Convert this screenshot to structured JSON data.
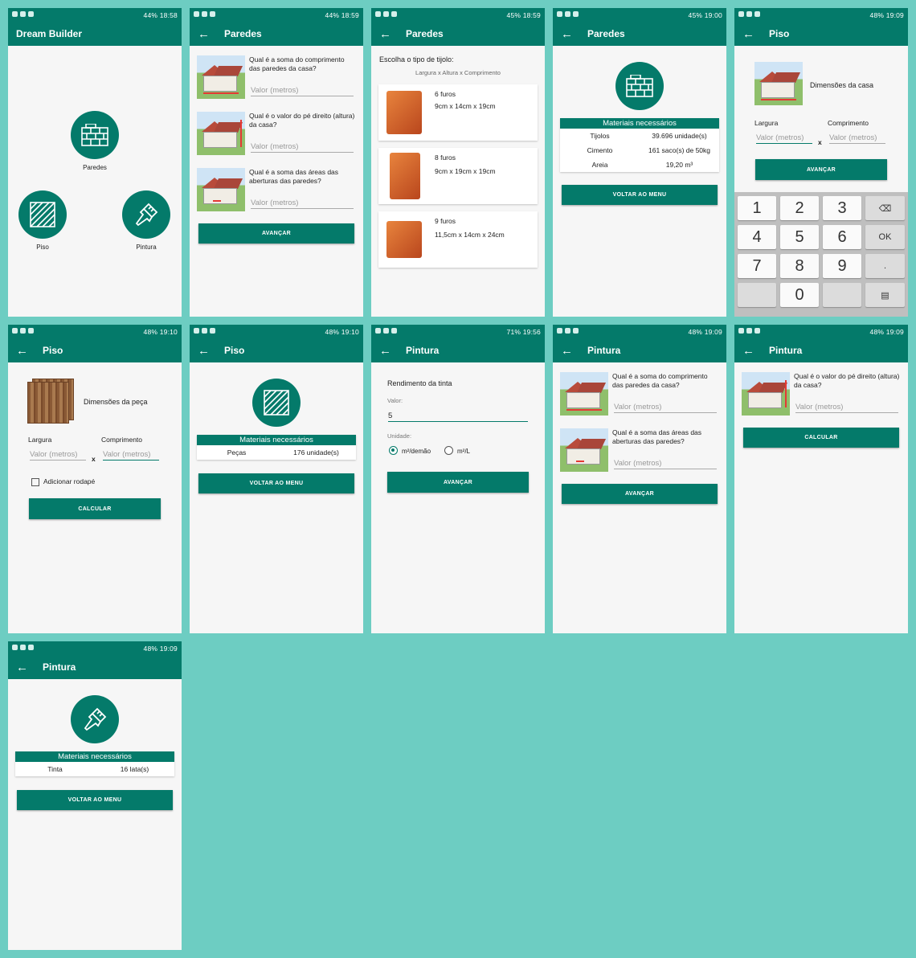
{
  "status_bar": {
    "s1_time": "18:58",
    "s1_batt": "44%",
    "s2_time": "18:59",
    "s2_batt": "44%",
    "s3_time": "18:59",
    "s3_batt": "45%",
    "s4_time": "19:00",
    "s4_batt": "45%",
    "s5_time": "19:09",
    "s5_batt": "48%",
    "s6_time": "19:10",
    "s6_batt": "48%",
    "s7_time": "19:10",
    "s7_batt": "48%",
    "s8_time": "19:56",
    "s8_batt": "71%",
    "s9_time": "19:09",
    "s9_batt": "48%",
    "s10_time": "19:09",
    "s10_batt": "48%",
    "s11_time": "19:09",
    "s11_batt": "48%"
  },
  "screen1": {
    "title": "Dream Builder",
    "paredes_label": "Paredes",
    "piso_label": "Piso",
    "pintura_label": "Pintura"
  },
  "screen2": {
    "title": "Paredes",
    "q1": "Qual é a soma do comprimento das paredes da casa?",
    "q2": "Qual é o valor do pé direito (altura) da casa?",
    "q3": "Qual é a soma das áreas das aberturas das paredes?",
    "placeholder": "Valor (metros)",
    "button": "AVANÇAR"
  },
  "screen3": {
    "title": "Paredes",
    "heading": "Escolha o tipo de tijolo:",
    "subheading": "Largura x Altura x Comprimento",
    "bricks": [
      {
        "name": "6 furos",
        "dims": "9cm x 14cm x 19cm"
      },
      {
        "name": "8 furos",
        "dims": "9cm x 19cm x 19cm"
      },
      {
        "name": "9 furos",
        "dims": "11,5cm x 14cm x 24cm"
      }
    ]
  },
  "screen4": {
    "title": "Paredes",
    "header": "Materiais necessários",
    "rows": [
      {
        "item": "Tijolos",
        "qty": "39.696 unidade(s)"
      },
      {
        "item": "Cimento",
        "qty": "161 saco(s) de 50kg"
      },
      {
        "item": "Areia",
        "qty": "19,20 m³"
      }
    ],
    "button": "VOLTAR AO MENU"
  },
  "screen5": {
    "title": "Piso",
    "dimension_label": "Dimensões da casa",
    "largura": "Largura",
    "comprimento": "Comprimento",
    "placeholder": "Valor (metros)",
    "x": "x",
    "button": "AVANÇAR",
    "keys": [
      "1",
      "2",
      "3",
      "4",
      "5",
      "6",
      "7",
      "8",
      "9",
      "0"
    ],
    "ok": "OK",
    "dot": "."
  },
  "screen6": {
    "title": "Piso",
    "dimension_label": "Dimensões da peça",
    "largura": "Largura",
    "comprimento": "Comprimento",
    "placeholder": "Valor (metros)",
    "x": "x",
    "checkbox": "Adicionar rodapé",
    "button": "CALCULAR"
  },
  "screen7": {
    "title": "Piso",
    "header": "Materiais necessários",
    "item": "Peças",
    "qty": "176 unidade(s)",
    "button": "VOLTAR AO MENU"
  },
  "screen8": {
    "title": "Pintura",
    "heading": "Rendimento da tinta",
    "valor_label": "Valor:",
    "valor": "5",
    "unidade_label": "Unidade:",
    "opt1": "m²/demão",
    "opt2": "m²/L",
    "button": "AVANÇAR"
  },
  "screen9": {
    "title": "Pintura",
    "q1": "Qual é a soma do comprimento das paredes da casa?",
    "q2": "Qual é a soma das áreas das aberturas das paredes?",
    "placeholder": "Valor (metros)",
    "button": "AVANÇAR"
  },
  "screen10": {
    "title": "Pintura",
    "q1": "Qual é o valor do pé direito (altura) da casa?",
    "placeholder": "Valor (metros)",
    "button": "CALCULAR"
  },
  "screen11": {
    "title": "Pintura",
    "header": "Materiais necessários",
    "item": "Tinta",
    "qty": "16 lata(s)",
    "button": "VOLTAR AO MENU"
  },
  "colors": {
    "primary": "#047a6a",
    "background": "#6dcdc2"
  }
}
